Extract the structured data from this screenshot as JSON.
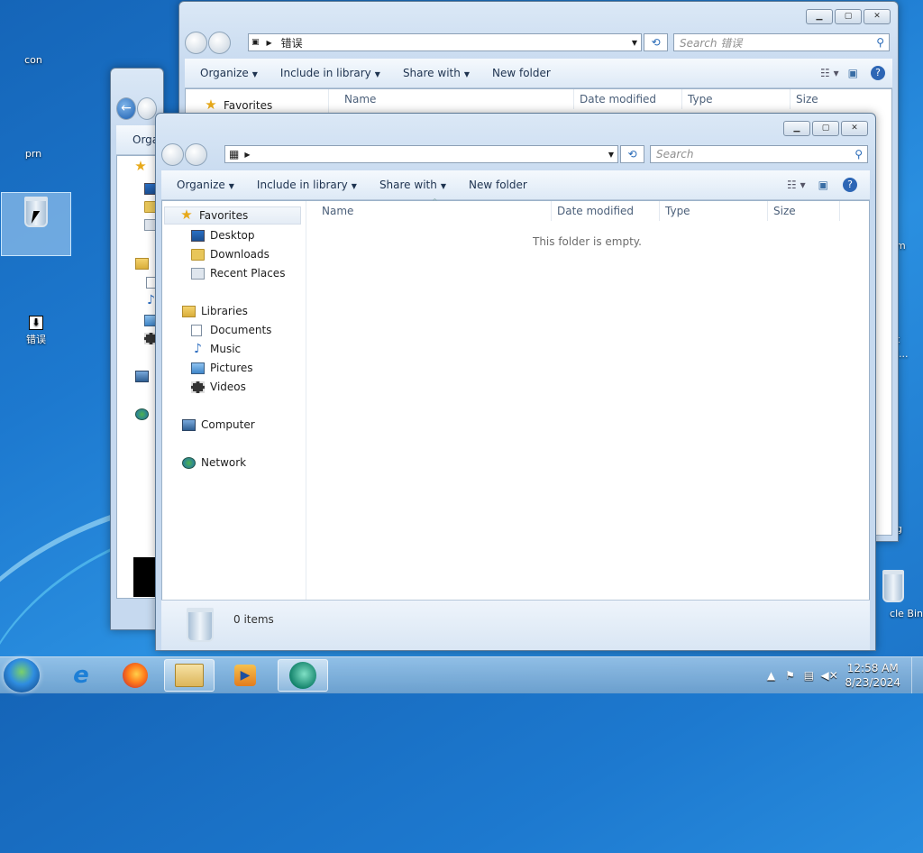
{
  "desktop": {
    "icons": [
      {
        "label": "con"
      },
      {
        "label": "prn"
      },
      {
        "label": "错误"
      },
      {
        "label": "cle Bin"
      }
    ],
    "edge_fragments": [
      "m",
      "t",
      "l...",
      "g"
    ]
  },
  "window_back": {
    "address_path": "错误",
    "search_placeholder": "Search 错误",
    "toolbar": {
      "organize": "Organize",
      "include": "Include in library",
      "share": "Share with",
      "new_folder": "New folder"
    },
    "columns": {
      "name": "Name",
      "date": "Date modified",
      "type": "Type",
      "size": "Size"
    },
    "nav_first": "Favorites"
  },
  "window_middle": {
    "toolbar_fragment": "Orga"
  },
  "window_front": {
    "address_path": "",
    "search_placeholder": "Search",
    "toolbar": {
      "organize": "Organize",
      "include": "Include in library",
      "share": "Share with",
      "new_folder": "New folder"
    },
    "columns": {
      "name": "Name",
      "date": "Date modified",
      "type": "Type",
      "size": "Size"
    },
    "empty_message": "This folder is empty.",
    "nav": {
      "favorites": "Favorites",
      "desktop": "Desktop",
      "downloads": "Downloads",
      "recent": "Recent Places",
      "libraries": "Libraries",
      "documents": "Documents",
      "music": "Music",
      "pictures": "Pictures",
      "videos": "Videos",
      "computer": "Computer",
      "network": "Network"
    },
    "status_text": "0 items"
  },
  "taskbar": {
    "time": "12:58 AM",
    "date": "8/23/2024"
  }
}
